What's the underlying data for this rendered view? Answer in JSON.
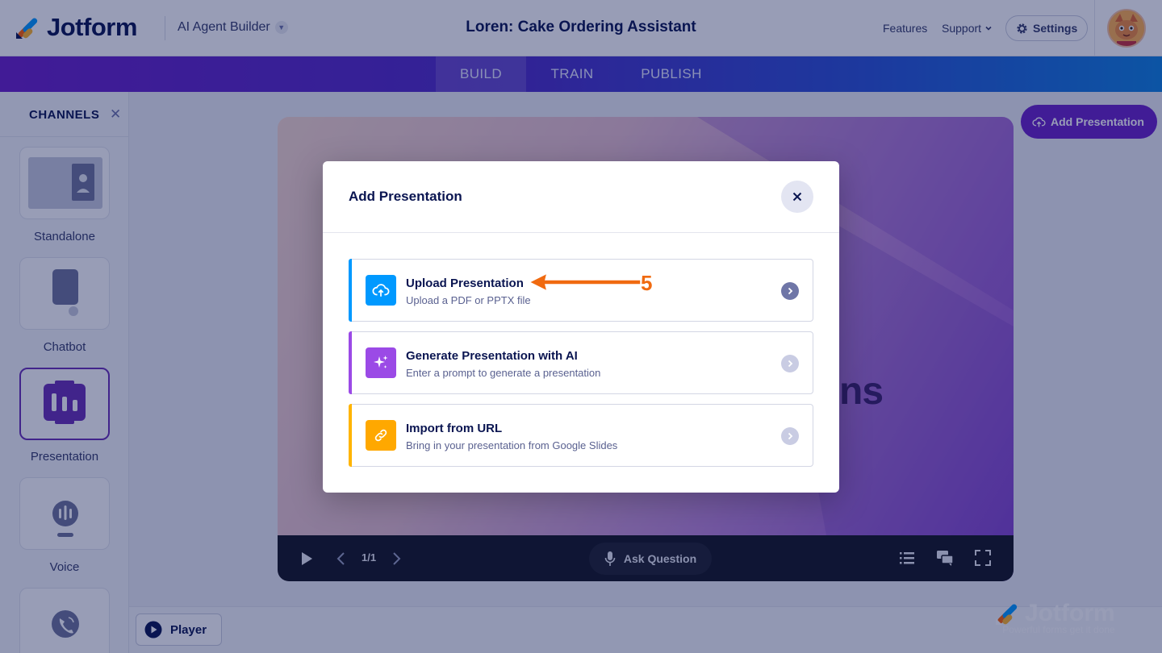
{
  "header": {
    "logo_text": "Jotform",
    "builder_label": "AI Agent Builder",
    "agent_title": "Loren: Cake Ordering Assistant",
    "nav": {
      "features": "Features",
      "support": "Support",
      "settings": "Settings"
    }
  },
  "tabs": [
    {
      "label": "BUILD",
      "active": true
    },
    {
      "label": "TRAIN",
      "active": false
    },
    {
      "label": "PUBLISH",
      "active": false
    }
  ],
  "sidebar": {
    "title": "CHANNELS",
    "items": [
      {
        "label": "Standalone",
        "icon": "standalone-icon"
      },
      {
        "label": "Chatbot",
        "icon": "chatbot-icon"
      },
      {
        "label": "Presentation",
        "icon": "presentation-icon",
        "active": true
      },
      {
        "label": "Voice",
        "icon": "voice-icon"
      },
      {
        "label": "",
        "icon": "phone-icon"
      }
    ]
  },
  "preview": {
    "add_presentation_label": "Add Presentation",
    "slide_partial_text": "ns",
    "controls": {
      "page": "1/1",
      "ask_question": "Ask Question"
    },
    "player_label": "Player"
  },
  "watermark": {
    "text": "Jotform",
    "tagline": "Powerful forms get it done"
  },
  "modal": {
    "title": "Add Presentation",
    "options": [
      {
        "title": "Upload Presentation",
        "subtitle": "Upload a PDF or PPTX file",
        "accent": "#0099ff",
        "icon": "upload-cloud-icon"
      },
      {
        "title": "Generate Presentation with AI",
        "subtitle": "Enter a prompt to generate a presentation",
        "accent": "#9b4ae6",
        "icon": "sparkle-icon"
      },
      {
        "title": "Import from URL",
        "subtitle": "Bring in your presentation from Google Slides",
        "accent": "#ffb400",
        "icon": "link-icon"
      }
    ]
  },
  "annotation": {
    "step_number": "5",
    "color": "#f06a10"
  }
}
